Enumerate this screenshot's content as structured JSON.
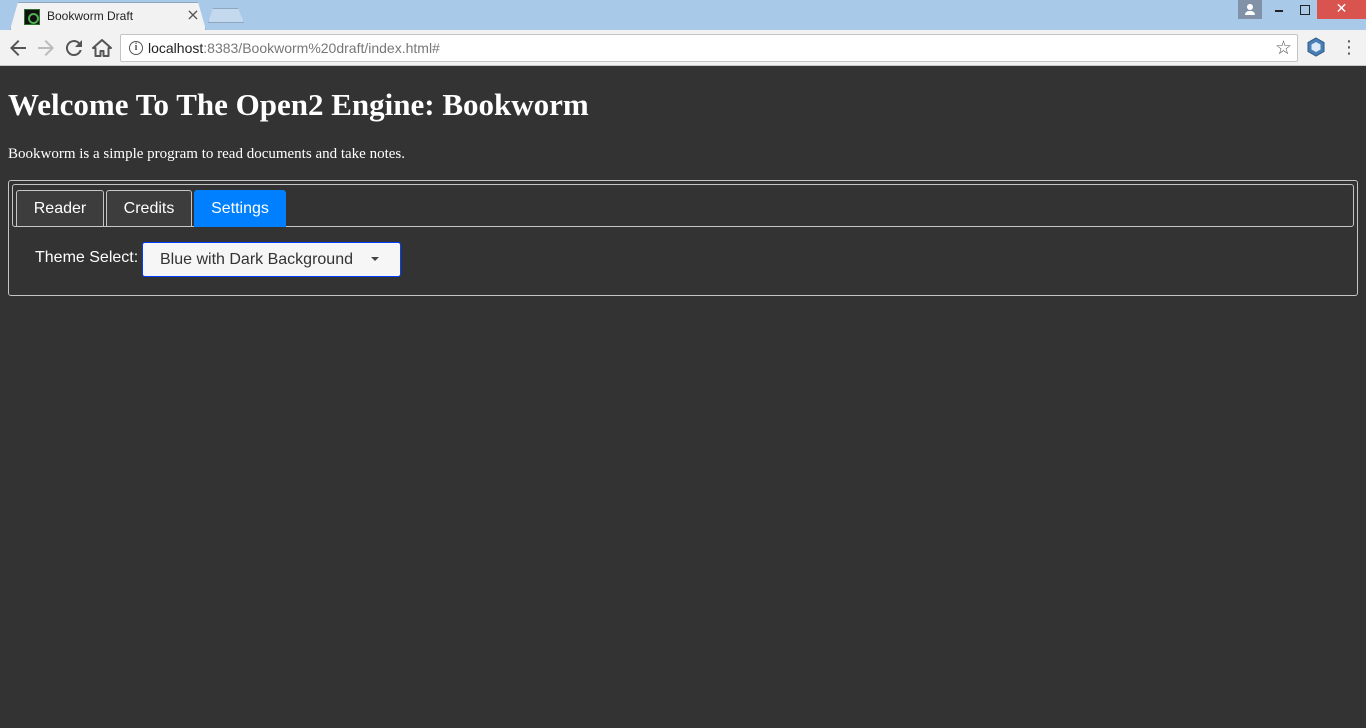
{
  "browser": {
    "tab_title": "Bookworm Draft",
    "tab_close": "×",
    "url_host": "localhost",
    "url_path": ":8383/Bookworm%20draft/index.html#",
    "icons": {
      "back": "arrow-left-icon",
      "forward": "arrow-right-icon",
      "reload": "reload-icon",
      "home": "home-icon",
      "info": "info-icon",
      "star": "star-icon",
      "extension": "extension-icon",
      "menu": "menu-icon"
    }
  },
  "page": {
    "title": "Welcome To The Open2 Engine: Bookworm",
    "description": "Bookworm is a simple program to read documents and take notes."
  },
  "tabs": [
    {
      "label": "Reader",
      "active": false
    },
    {
      "label": "Credits",
      "active": false
    },
    {
      "label": "Settings",
      "active": true
    }
  ],
  "settings": {
    "theme_label": "Theme Select:",
    "theme_value": "Blue with Dark Background"
  },
  "colors": {
    "page_background": "#333333",
    "active_tab": "#007fff",
    "select_border": "#003eff",
    "title_bar": "#a9c9e9",
    "close_button": "#d9534f"
  }
}
